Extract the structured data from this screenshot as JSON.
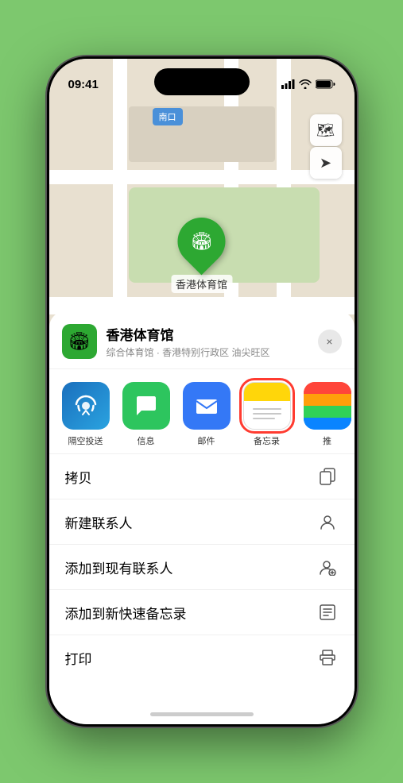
{
  "statusBar": {
    "time": "09:41",
    "locationIcon": "▲"
  },
  "mapBadge": {
    "text": "南口"
  },
  "mapControls": [
    {
      "icon": "🗺",
      "name": "map-type"
    },
    {
      "icon": "➤",
      "name": "location"
    }
  ],
  "stadiumMarker": {
    "label": "香港体育馆",
    "icon": "🏟"
  },
  "bottomSheet": {
    "venueName": "香港体育馆",
    "venueSubtitle": "综合体育馆 · 香港特别行政区 油尖旺区",
    "closeLabel": "×",
    "shareItems": [
      {
        "id": "airdrop",
        "label": "隔空投送",
        "type": "airdrop"
      },
      {
        "id": "messages",
        "label": "信息",
        "type": "messages"
      },
      {
        "id": "mail",
        "label": "邮件",
        "type": "mail"
      },
      {
        "id": "notes",
        "label": "备忘录",
        "type": "notes",
        "selected": true
      },
      {
        "id": "more",
        "label": "推",
        "type": "more"
      }
    ],
    "actions": [
      {
        "id": "copy",
        "label": "拷贝",
        "icon": "⧉"
      },
      {
        "id": "new-contact",
        "label": "新建联系人",
        "icon": "👤"
      },
      {
        "id": "add-existing",
        "label": "添加到现有联系人",
        "icon": "👤"
      },
      {
        "id": "add-note",
        "label": "添加到新快速备忘录",
        "icon": "📋"
      },
      {
        "id": "print",
        "label": "打印",
        "icon": "🖨"
      }
    ]
  }
}
